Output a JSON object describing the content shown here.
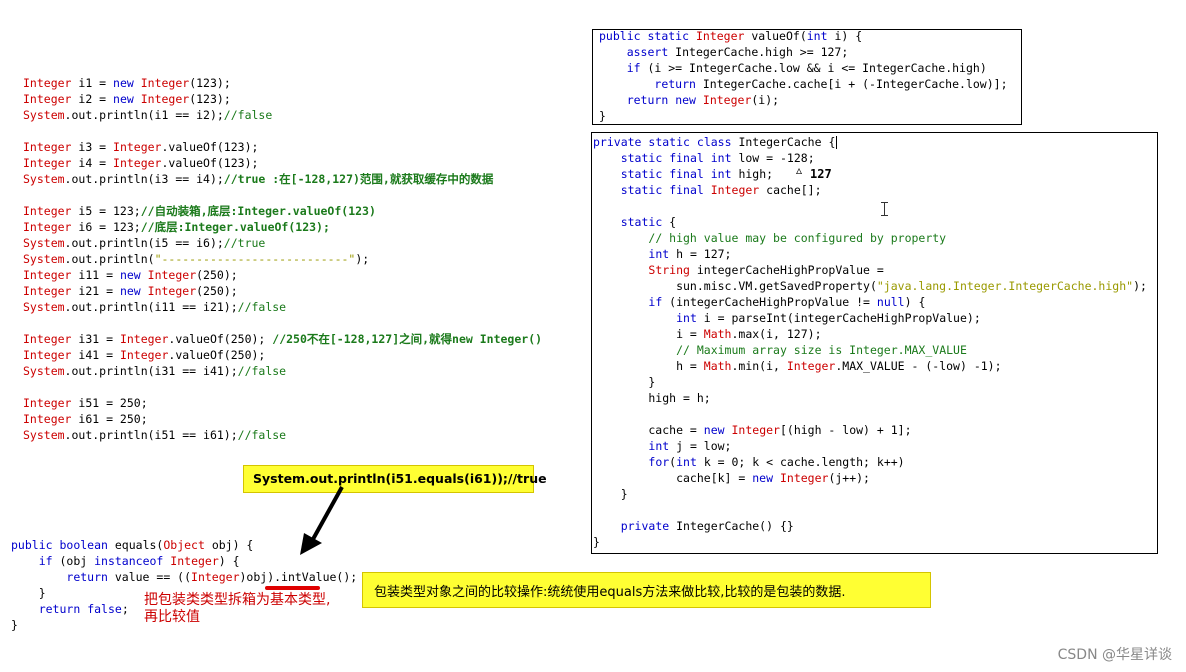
{
  "left_code": [
    "Integer i1 = new Integer(123);",
    "Integer i2 = new Integer(123);",
    "System.out.println(i1 == i2);//false",
    "",
    "Integer i3 = Integer.valueOf(123);",
    "Integer i4 = Integer.valueOf(123);",
    "System.out.println(i3 == i4);//true :在[-128,127)范围,就获取缓存中的数据",
    "",
    "Integer i5 = 123;//自动装箱,底层:Integer.valueOf(123)",
    "Integer i6 = 123;//底层:Integer.valueOf(123);",
    "System.out.println(i5 == i6);//true",
    "System.out.println(\"---------------------------\");",
    "Integer i11 = new Integer(250);",
    "Integer i21 = new Integer(250);",
    "System.out.println(i11 == i21);//false",
    "",
    "Integer i31 = Integer.valueOf(250); //250不在[-128,127]之间,就得new Integer()",
    "Integer i41 = Integer.valueOf(250);",
    "System.out.println(i31 == i41);//false",
    "",
    "Integer i51 = 250;",
    "Integer i61 = 250;",
    "System.out.println(i51 == i61);//false"
  ],
  "valueof_code": [
    "public static Integer valueOf(int i) {",
    "    assert IntegerCache.high >= 127;",
    "    if (i >= IntegerCache.low && i <= IntegerCache.high)",
    "        return IntegerCache.cache[i + (-IntegerCache.low)];",
    "    return new Integer(i);",
    "}"
  ],
  "cache_code": [
    "private static class IntegerCache {",
    "    static final int low = -128;",
    "    static final int high;",
    "    static final Integer cache[];",
    "",
    "    static {",
    "        // high value may be configured by property",
    "        int h = 127;",
    "        String integerCacheHighPropValue =",
    "            sun.misc.VM.getSavedProperty(\"java.lang.Integer.IntegerCache.high\");",
    "        if (integerCacheHighPropValue != null) {",
    "            int i = parseInt(integerCacheHighPropValue);",
    "            i = Math.max(i, 127);",
    "            // Maximum array size is Integer.MAX_VALUE",
    "            h = Math.min(i, Integer.MAX_VALUE - (-low) -1);",
    "        }",
    "        high = h;",
    "",
    "        cache = new Integer[(high - low) + 1];",
    "        int j = low;",
    "        for(int k = 0; k < cache.length; k++)",
    "            cache[k] = new Integer(j++);",
    "    }",
    "",
    "    private IntegerCache() {}",
    "}"
  ],
  "equals_code": [
    "public boolean equals(Object obj) {",
    "    if (obj instanceof Integer) {",
    "        return value == ((Integer)obj).intValue();",
    "    }",
    "    return false;",
    "}"
  ],
  "annotation_127": "127",
  "callout_equals": "System.out.println(i51.equals(i61));//true",
  "callout_compare": "包装类型对象之间的比较操作:统统使用equals方法来做比较,比较的是包装的数据.",
  "note_unbox_line1": "把包装类类型拆箱为基本类型,",
  "note_unbox_line2": "再比较值",
  "watermark": "CSDN @华星详谈",
  "colors": {
    "keyword": "#0000cc",
    "type": "#cc0000",
    "comment": "#1b7a1b",
    "string": "#999900",
    "callout_bg": "#ffff33",
    "annotation": "#cc0000"
  }
}
